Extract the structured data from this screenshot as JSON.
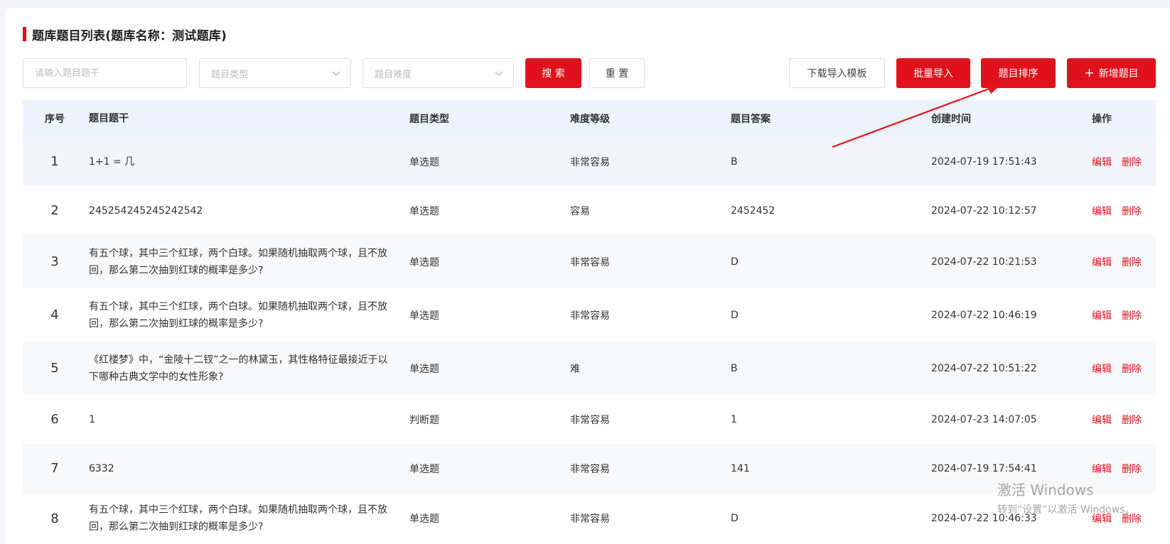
{
  "page": {
    "title": "题库题目列表(题库名称：测试题库)"
  },
  "filters": {
    "stem_placeholder": "请输入题目题干",
    "type_placeholder": "题目类型",
    "difficulty_placeholder": "题目难度"
  },
  "toolbar": {
    "search_label": "搜 索",
    "reset_label": "重 置",
    "download_template_label": "下载导入模板",
    "batch_import_label": "批量导入",
    "sort_label": "题目排序",
    "add_label": "新增题目",
    "add_icon": "plus-icon"
  },
  "colors": {
    "accent": "#e0111c",
    "header_bg": "#edf3fb"
  },
  "table": {
    "columns": [
      "序号",
      "题目题干",
      "题目类型",
      "难度等级",
      "题目答案",
      "创建时间",
      "操作"
    ],
    "rows": [
      {
        "idx": "1",
        "stem": "1+1 = 几",
        "type": "单选题",
        "difficulty": "非常容易",
        "answer": "B",
        "created": "2024-07-19 17:51:43",
        "edit": "编辑",
        "delete": "删除"
      },
      {
        "idx": "2",
        "stem": "245254245245242542",
        "type": "单选题",
        "difficulty": "容易",
        "answer": "2452452",
        "created": "2024-07-22 10:12:57",
        "edit": "编辑",
        "delete": "删除"
      },
      {
        "idx": "3",
        "stem": "有五个球，其中三个红球，两个白球。如果随机抽取两个球，且不放回，那么第二次抽到红球的概率是多少?",
        "type": "单选题",
        "difficulty": "非常容易",
        "answer": "D",
        "created": "2024-07-22 10:21:53",
        "edit": "编辑",
        "delete": "删除"
      },
      {
        "idx": "4",
        "stem": "有五个球，其中三个红球，两个白球。如果随机抽取两个球，且不放回，那么第二次抽到红球的概率是多少?",
        "type": "单选题",
        "difficulty": "非常容易",
        "answer": "D",
        "created": "2024-07-22 10:46:19",
        "edit": "编辑",
        "delete": "删除"
      },
      {
        "idx": "5",
        "stem": "《红楼梦》中，“金陵十二钗”之一的林黛玉，其性格特征最接近于以下哪种古典文学中的女性形象?",
        "type": "单选题",
        "difficulty": "难",
        "answer": "B",
        "created": "2024-07-22 10:51:22",
        "edit": "编辑",
        "delete": "删除"
      },
      {
        "idx": "6",
        "stem": "1",
        "type": "判断题",
        "difficulty": "非常容易",
        "answer": "1",
        "created": "2024-07-23 14:07:05",
        "edit": "编辑",
        "delete": "删除"
      },
      {
        "idx": "7",
        "stem": "6332",
        "type": "单选题",
        "difficulty": "非常容易",
        "answer": "141",
        "created": "2024-07-19 17:54:41",
        "edit": "编辑",
        "delete": "删除"
      },
      {
        "idx": "8",
        "stem": "有五个球，其中三个红球，两个白球。如果随机抽取两个球，且不放回，那么第二次抽到红球的概率是多少?",
        "type": "单选题",
        "difficulty": "非常容易",
        "answer": "D",
        "created": "2024-07-22 10:46:33",
        "edit": "编辑",
        "delete": "删除"
      }
    ]
  },
  "watermark": {
    "line1": "激活 Windows",
    "line2": "转到“设置”以激活 Windows。"
  }
}
